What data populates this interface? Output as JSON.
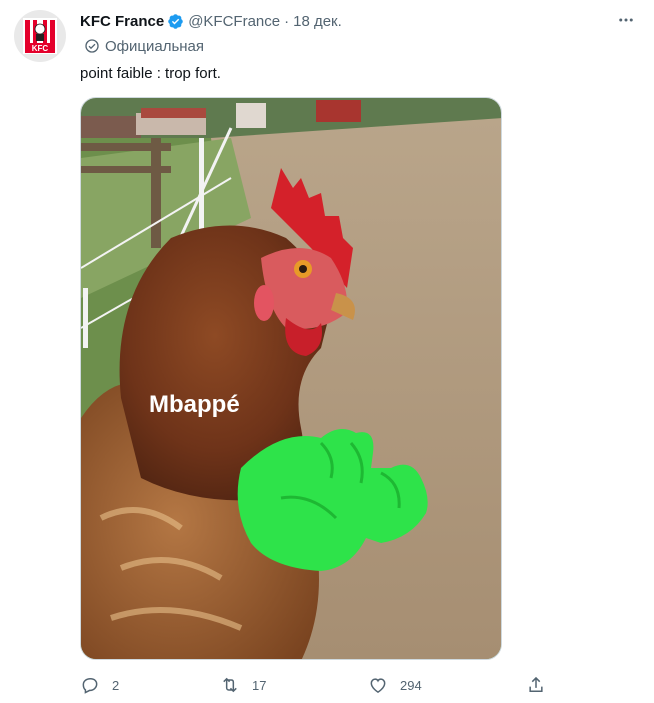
{
  "author": {
    "display_name": "KFC France",
    "handle": "@KFCFrance",
    "separator": "·",
    "date": "18 дек.",
    "label": "Официальная",
    "avatar_logo_text": "KFC"
  },
  "tweet": {
    "text": "point faible : trop fort."
  },
  "media": {
    "caption_overlay": "Mbappé",
    "overlay_color": "#2ee34a"
  },
  "actions": {
    "reply_count": "2",
    "retweet_count": "17",
    "like_count": "294"
  },
  "icons": [
    "more-icon",
    "verified-badge-icon",
    "official-badge-icon",
    "reply-icon",
    "retweet-icon",
    "like-icon",
    "share-icon"
  ],
  "colors": {
    "text_primary": "#0f1419",
    "text_secondary": "#536471",
    "verified_blue": "#1d9bf0",
    "kfc_red": "#e4002b"
  }
}
